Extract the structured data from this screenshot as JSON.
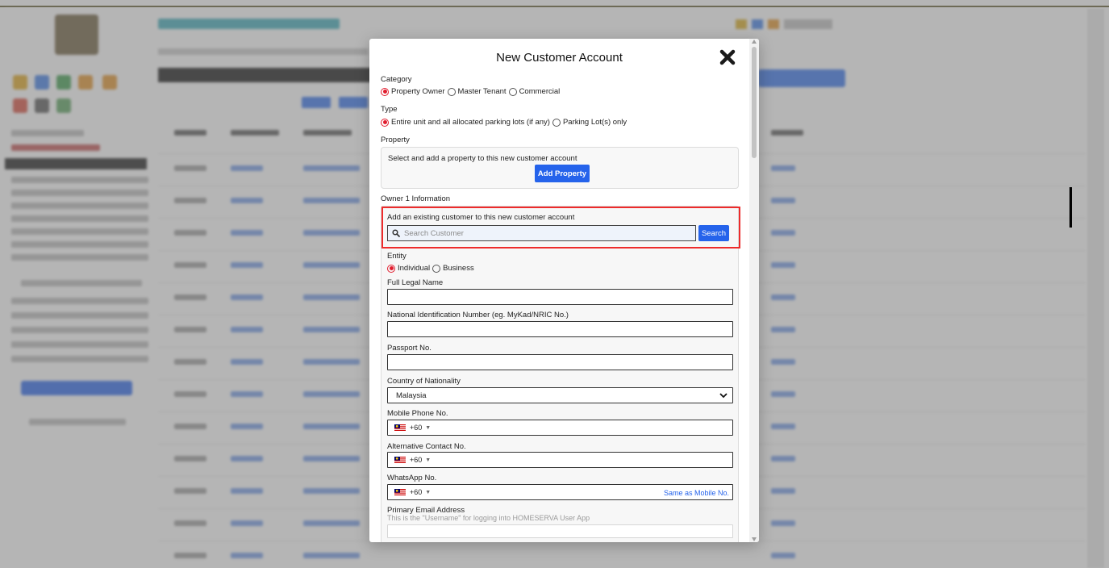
{
  "modal": {
    "title": "New Customer Account",
    "category": {
      "label": "Category",
      "options": [
        {
          "label": "Property Owner",
          "checked": true
        },
        {
          "label": "Master Tenant",
          "checked": false
        },
        {
          "label": "Commercial",
          "checked": false
        }
      ]
    },
    "type": {
      "label": "Type",
      "options": [
        {
          "label": "Entire unit and all allocated parking lots (if any)",
          "checked": true
        },
        {
          "label": "Parking Lot(s) only",
          "checked": false
        }
      ]
    },
    "property": {
      "label": "Property",
      "description": "Select and add a property to this new customer account",
      "add_button": "Add Property"
    },
    "owner": {
      "section_label": "Owner 1 Information",
      "existing_label": "Add an existing customer to this new customer account",
      "search_placeholder": "Search Customer",
      "search_button": "Search",
      "entity": {
        "label": "Entity",
        "options": [
          {
            "label": "Individual",
            "checked": true
          },
          {
            "label": "Business",
            "checked": false
          }
        ]
      },
      "full_name_label": "Full Legal Name",
      "nric_label": "National Identification Number (eg. MyKad/NRIC No.)",
      "passport_label": "Passport No.",
      "nationality_label": "Country of Nationality",
      "nationality_value": "Malaysia",
      "mobile_label": "Mobile Phone No.",
      "mobile_code": "+60",
      "alt_label": "Alternative Contact No.",
      "alt_code": "+60",
      "whatsapp_label": "WhatsApp No.",
      "whatsapp_code": "+60",
      "same_as_mobile": "Same as Mobile No.",
      "email_label": "Primary Email Address",
      "email_hint": "This is the \"Username\" for logging into HOMESERVA User App"
    }
  },
  "colors": {
    "accent_blue": "#2563eb",
    "highlight_red": "#ee2b2b",
    "radio_red": "#e11d2e"
  }
}
